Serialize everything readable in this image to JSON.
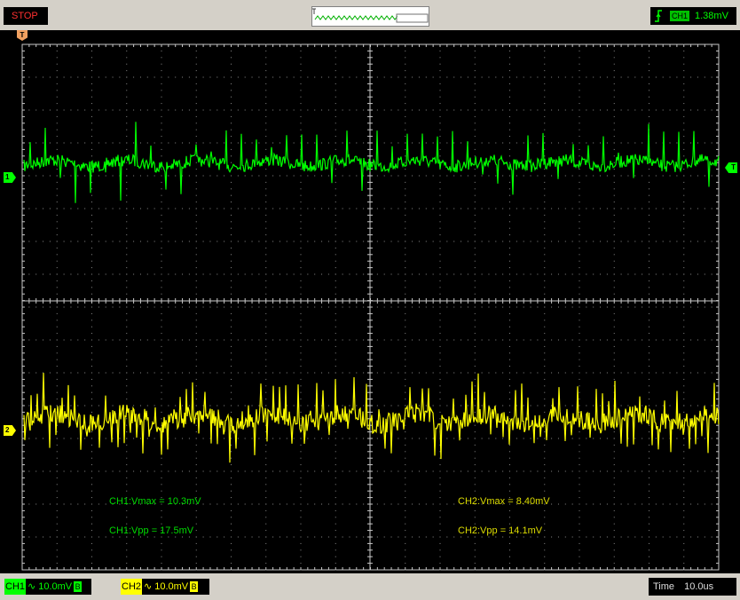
{
  "toolbar": {
    "run_state": "STOP",
    "trigger_source": "CH1",
    "trigger_level": "1.38mV",
    "trigger_edge_icon": "rising-edge-icon",
    "waveform_overview_icon": "waveform-overview-icon"
  },
  "screen": {
    "trigger_position_marker": "T",
    "trigger_level_marker": "T",
    "channel_markers": [
      {
        "label": "1",
        "color": "#00ff00"
      },
      {
        "label": "2",
        "color": "#ffff00"
      }
    ],
    "measurements": {
      "ch1_vmax": "CH1:Vmax = 10.3mV",
      "ch1_vpp": "CH1:Vpp = 17.5mV",
      "ch2_vmax": "CH2:Vmax = 8.40mV",
      "ch2_vpp": "CH2:Vpp = 14.1mV"
    },
    "colors": {
      "ch1": "#00ff00",
      "ch2": "#ffff00",
      "grid": "#c8c8c8",
      "background": "#000000"
    }
  },
  "status": {
    "ch1_label": "CH1",
    "ch1_coupling": "∿",
    "ch1_scale": "10.0mV",
    "ch1_bw": "B",
    "ch2_label": "CH2",
    "ch2_coupling": "∿",
    "ch2_scale": "10.0mV",
    "ch2_bw": "B",
    "time_label": "Time",
    "time_scale": "10.0us"
  }
}
